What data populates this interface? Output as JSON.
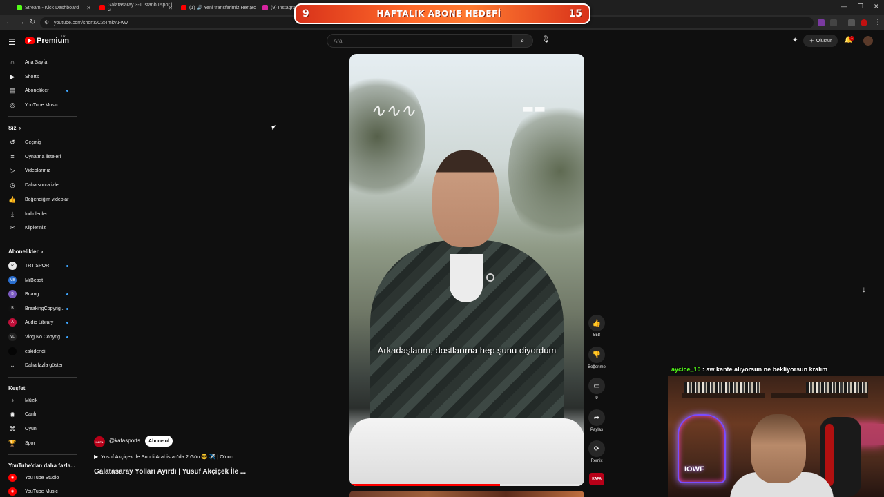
{
  "browser": {
    "tabs": [
      {
        "title": "Stream - Kick Dashboard",
        "color": "#53fc18"
      },
      {
        "title": "Galatasaray 3-1 İstanbulspor | G",
        "color": "#ff0000"
      },
      {
        "title": "(1) 🔊 Yeni transferimiz Renato",
        "color": "#ff0000"
      },
      {
        "title": "(9) Instagram",
        "color": "#d6249f"
      }
    ],
    "url": "youtube.com/shorts/C2t4mkvu-ww"
  },
  "overlay": {
    "left_count": "9",
    "title": "HAFTALIK ABONE HEDEFİ",
    "right_count": "15"
  },
  "header": {
    "logo_text": "Premium",
    "region": "TR",
    "search_placeholder": "Ara",
    "create_label": "Oluştur",
    "notification_count": "1"
  },
  "sidebar": {
    "main": [
      {
        "label": "Ana Sayfa",
        "icon": "home-icon",
        "glyph": "⌂"
      },
      {
        "label": "Shorts",
        "icon": "shorts-icon",
        "glyph": "▶"
      },
      {
        "label": "Abonelikler",
        "icon": "subscriptions-icon",
        "glyph": "▤"
      },
      {
        "label": "YouTube Music",
        "icon": "music-icon",
        "glyph": "◎"
      }
    ],
    "you_title": "Siz",
    "you": [
      {
        "label": "Geçmiş",
        "icon": "history-icon",
        "glyph": "↺"
      },
      {
        "label": "Oynatma listeleri",
        "icon": "playlists-icon",
        "glyph": "≡"
      },
      {
        "label": "Videolarınız",
        "icon": "your-videos-icon",
        "glyph": "▷"
      },
      {
        "label": "Daha sonra izle",
        "icon": "watch-later-icon",
        "glyph": "◷"
      },
      {
        "label": "Beğendiğim videolar",
        "icon": "liked-icon",
        "glyph": "👍"
      },
      {
        "label": "İndirilenler",
        "icon": "downloads-icon",
        "glyph": "⤓"
      },
      {
        "label": "Klipleriniz",
        "icon": "clips-icon",
        "glyph": "✂"
      }
    ],
    "subs_title": "Abonelikler",
    "subs": [
      {
        "label": "TRT SPOR",
        "color": "#e8e8e8",
        "text": "TRT"
      },
      {
        "label": "MrBeast",
        "color": "#2a6fd0",
        "text": "MB"
      },
      {
        "label": "Buang",
        "color": "#7a5ac0",
        "text": "B"
      },
      {
        "label": "BreakingCopyrig...",
        "color": "#111111",
        "text": "B"
      },
      {
        "label": "Audio Library",
        "color": "#c0103a",
        "text": "A"
      },
      {
        "label": "Vlog No Copyrig...",
        "color": "#222222",
        "text": "VL"
      },
      {
        "label": "eskidendi",
        "color": "#050505",
        "text": ""
      }
    ],
    "show_more": "Daha fazla göster",
    "explore_title": "Keşfet",
    "explore": [
      {
        "label": "Müzik",
        "icon": "music-note-icon",
        "glyph": "♪"
      },
      {
        "label": "Canlı",
        "icon": "live-icon",
        "glyph": "◉"
      },
      {
        "label": "Oyun",
        "icon": "gaming-icon",
        "glyph": "⌘"
      },
      {
        "label": "Spor",
        "icon": "trophy-icon",
        "glyph": "🏆"
      }
    ],
    "more_title": "YouTube'dan daha fazla...",
    "more": [
      {
        "label": "YouTube Studio",
        "color": "#ff0000"
      },
      {
        "label": "YouTube Music",
        "color": "#ff0000"
      }
    ]
  },
  "video": {
    "subtitle": "Arkadaşlarım, dostlarıma hep şunu diyordum",
    "progress": 0.64,
    "channel": "@kafasports",
    "subscribe": "Abone ol",
    "related": "Yusuf Akçiçek İle Suudi Arabistan'da 2 Gün 😎 ✈️ | O'nun ...",
    "title": "Galatasaray Yolları Ayırdı | Yusuf Akçiçek İle ...",
    "actions": {
      "likes": "558",
      "dislike": "Beğenme",
      "comments": "9",
      "share": "Paylaş",
      "remix": "Remix"
    }
  },
  "chat": {
    "user": "aycice_10",
    "message": "aw kante alıyorsun ne bekliyorsun kralım"
  }
}
